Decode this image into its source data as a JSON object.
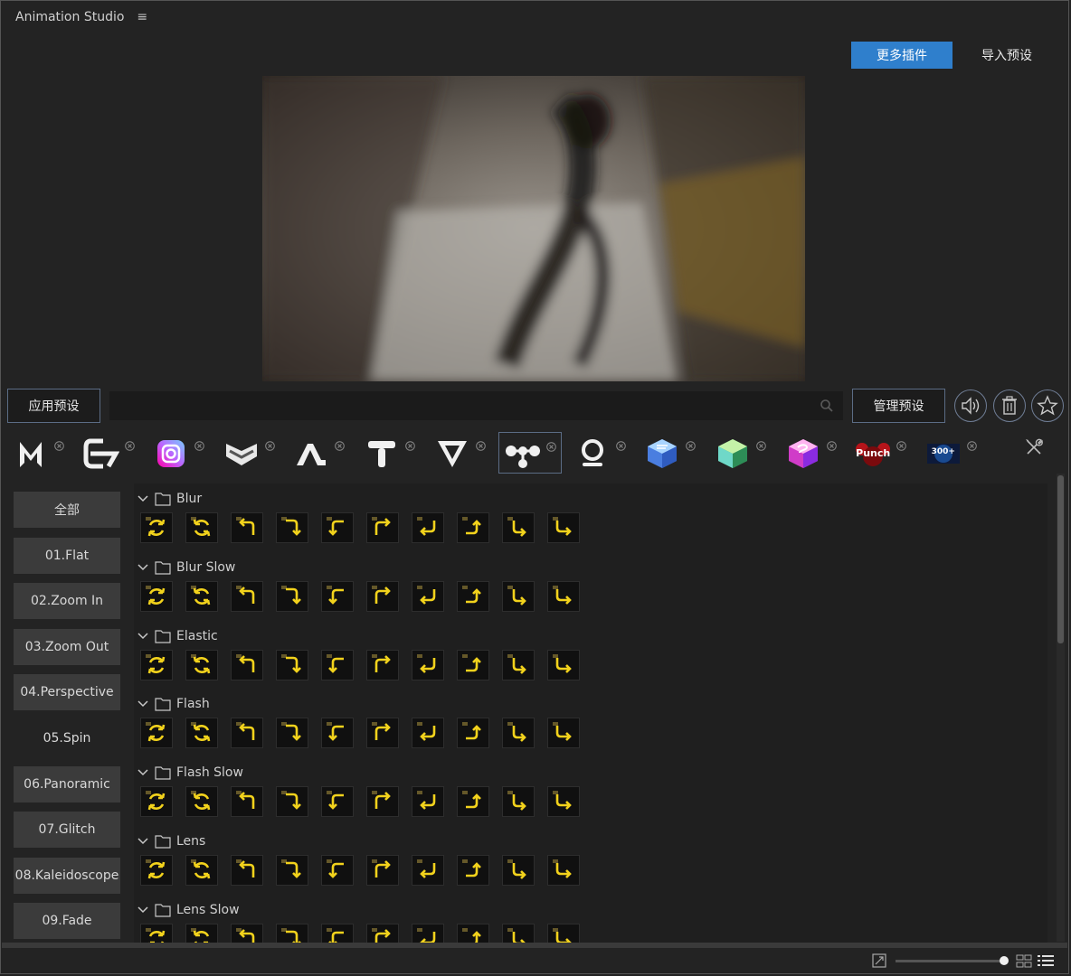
{
  "app": {
    "title": "Animation Studio"
  },
  "top_actions": {
    "more_plugins": "更多插件",
    "import_preset": "导入预设"
  },
  "toolbar": {
    "apply_preset": "应用预设",
    "search_placeholder": "",
    "manage_preset": "管理预设",
    "icons": [
      "speaker-icon",
      "trash-icon",
      "star-icon"
    ]
  },
  "plugins": [
    {
      "name": "plugin-m",
      "text": ""
    },
    {
      "name": "plugin-e",
      "text": ""
    },
    {
      "name": "plugin-instagram",
      "text": ""
    },
    {
      "name": "plugin-chevron-badge",
      "text": ""
    },
    {
      "name": "plugin-a",
      "text": ""
    },
    {
      "name": "plugin-t",
      "text": ""
    },
    {
      "name": "plugin-v",
      "text": ""
    },
    {
      "name": "plugin-nodes",
      "text": "",
      "selected": true
    },
    {
      "name": "plugin-o",
      "text": ""
    },
    {
      "name": "plugin-blue-cube",
      "text": ""
    },
    {
      "name": "plugin-green-cube",
      "text": ""
    },
    {
      "name": "plugin-pink-cube",
      "text": ""
    },
    {
      "name": "plugin-punch",
      "text": "Punch"
    },
    {
      "name": "plugin-300",
      "text": "300+"
    }
  ],
  "categories": [
    {
      "label": "全部"
    },
    {
      "label": "01.Flat"
    },
    {
      "label": "02.Zoom In"
    },
    {
      "label": "03.Zoom Out"
    },
    {
      "label": "04.Perspective"
    },
    {
      "label": "05.Spin",
      "active": true
    },
    {
      "label": "06.Panoramic"
    },
    {
      "label": "07.Glitch"
    },
    {
      "label": "08.Kaleidoscope"
    },
    {
      "label": "09.Fade"
    }
  ],
  "groups": [
    {
      "name": "Blur"
    },
    {
      "name": "Blur Slow"
    },
    {
      "name": "Elastic"
    },
    {
      "name": "Flash"
    },
    {
      "name": "Flash Slow"
    },
    {
      "name": "Lens"
    },
    {
      "name": "Lens Slow"
    }
  ],
  "preset_icons": [
    "rotate-cw-icon",
    "rotate-ccw-icon",
    "turn-up-left-icon",
    "turn-down-right-icon",
    "turn-left-down-icon",
    "turn-up-right-icon",
    "return-left-icon",
    "turn-up-icon",
    "turn-down-left-icon",
    "turn-right-down-icon"
  ],
  "colors": {
    "accent": "#2f7fcc",
    "preset_yellow": "#f2d21c",
    "background": "#232323"
  }
}
